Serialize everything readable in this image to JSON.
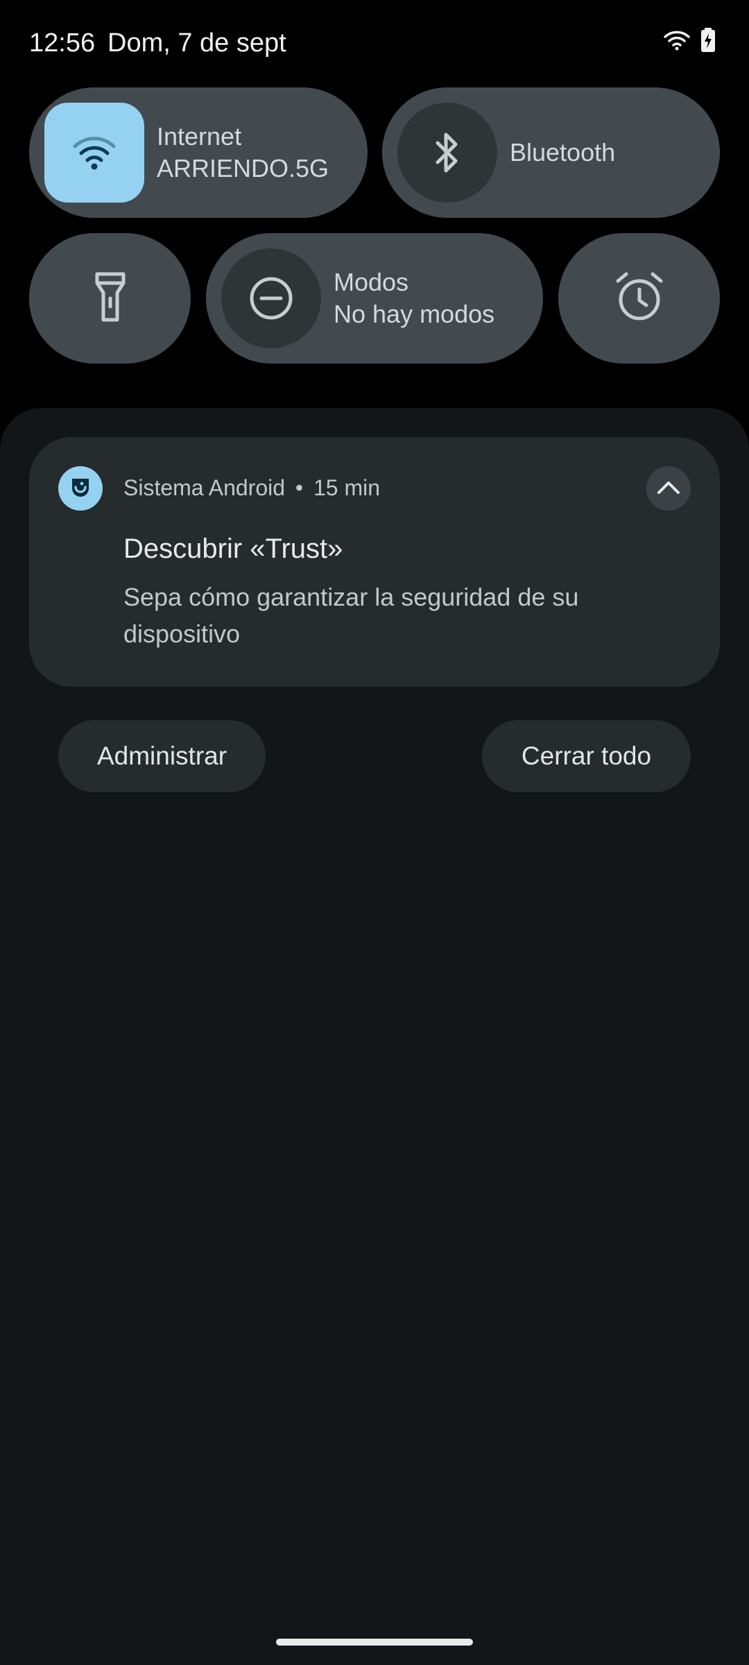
{
  "status_bar": {
    "time": "12:56",
    "date": "Dom, 7 de sept",
    "icons": [
      "wifi-icon",
      "battery-charging-icon"
    ]
  },
  "quick_settings": {
    "internet": {
      "label": "Internet",
      "subtitle": "ARRIENDO.5G",
      "icon": "wifi-icon",
      "active": true
    },
    "bluetooth": {
      "label": "Bluetooth",
      "icon": "bluetooth-icon",
      "active": false
    },
    "flashlight": {
      "icon": "flashlight-icon",
      "active": false
    },
    "modes": {
      "label": "Modos",
      "subtitle": "No hay modos",
      "icon": "do-not-disturb-icon",
      "active": false
    },
    "alarm": {
      "icon": "alarm-icon",
      "active": false
    }
  },
  "notification": {
    "app_name": "Sistema Android",
    "separator": "•",
    "time_ago": "15 min",
    "title": "Descubrir «Trust»",
    "body": "Sepa cómo garantizar la seguridad de su dispositivo",
    "app_icon": "trust-icon",
    "collapse_icon": "chevron-up-icon"
  },
  "actions": {
    "manage": "Administrar",
    "clear_all": "Cerrar todo"
  },
  "colors": {
    "tile_bg": "#434a4f",
    "tile_active": "#95d2f1",
    "shade_bg": "#121619",
    "card_bg": "#262b2e"
  }
}
